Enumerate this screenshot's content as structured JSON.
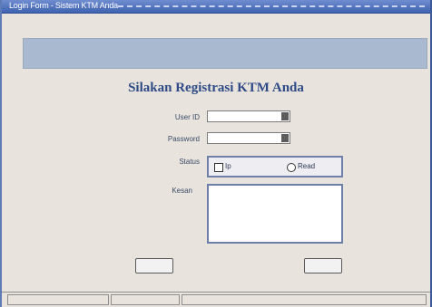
{
  "window": {
    "title": "Login Form - Sistem KTM Anda"
  },
  "heading": "Silakan Registrasi KTM Anda",
  "form": {
    "user_id_label": "User ID",
    "user_id_value": "",
    "password_label": "Password",
    "password_value": "",
    "status_label": "Status",
    "status_options": [
      "Ip",
      "Read"
    ],
    "status_selected": "Read",
    "note_label": "Kesan",
    "note_value": ""
  },
  "buttons": {
    "ok_label": "",
    "cancel_label": ""
  },
  "statusbar": {
    "cells": [
      "",
      "",
      ""
    ]
  },
  "colors": {
    "title_bar": "#3f63b0",
    "banner": "#a9b9cf",
    "heading": "#2e4a86",
    "frame_border": "#6e7fa8"
  },
  "icons": {
    "field_button": "dropdown-icon",
    "check": "checkbox-icon",
    "radio": "radio-icon"
  }
}
